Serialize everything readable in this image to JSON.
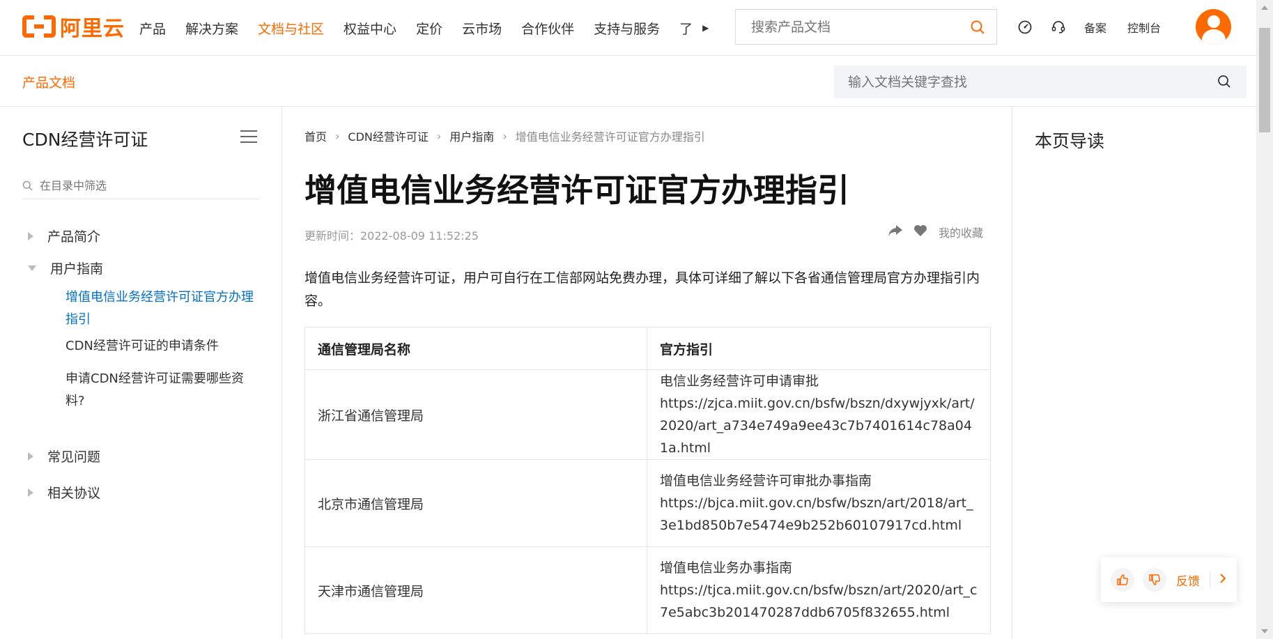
{
  "brand": {
    "logo_text": "阿里云",
    "accent": "#ff6a00",
    "link": "#0070cc"
  },
  "topnav": {
    "items": [
      {
        "label": "产品"
      },
      {
        "label": "解决方案"
      },
      {
        "label": "文档与社区",
        "active": true
      },
      {
        "label": "权益中心"
      },
      {
        "label": "定价"
      },
      {
        "label": "云市场"
      },
      {
        "label": "合作伙伴"
      },
      {
        "label": "支持与服务"
      },
      {
        "label": "了"
      }
    ],
    "search_placeholder": "搜索产品文档",
    "beian": "备案",
    "console": "控制台"
  },
  "subheader": {
    "product_docs": "产品文档",
    "doc_search_placeholder": "输入文档关键字查找"
  },
  "sidebar": {
    "title": "CDN经营许可证",
    "filter_placeholder": "在目录中筛选",
    "items": [
      {
        "label": "产品简介",
        "expanded": false
      },
      {
        "label": "用户指南",
        "expanded": true
      },
      {
        "label": "常见问题",
        "expanded": false
      },
      {
        "label": "相关协议",
        "expanded": false
      }
    ],
    "sub_items": [
      {
        "label": "增值电信业务经营许可证官方办理指引",
        "active": true
      },
      {
        "label": "CDN经营许可证的申请条件"
      },
      {
        "label": "申请CDN经营许可证需要哪些资料?"
      }
    ]
  },
  "breadcrumb": [
    "首页",
    "CDN经营许可证",
    "用户指南",
    "增值电信业务经营许可证官方办理指引"
  ],
  "article": {
    "title": "增值电信业务经营许可证官方办理指引",
    "updated": "更新时间：2022-08-09 11:52:25",
    "favorite_label": "我的收藏",
    "intro": "增值电信业务经营许可证，用户可自行在工信部网站免费办理，具体可详细了解以下各省通信管理局官方办理指引内容。",
    "table": {
      "headers": [
        "通信管理局名称",
        "官方指引"
      ],
      "rows": [
        {
          "bureau": "浙江省通信管理局",
          "guide_title": "电信业务经营许可申请审批",
          "url": "https://zjca.miit.gov.cn/bsfw/bszn/dxywjyxk/art/2020/art_a734e749a9ee43c7b7401614c78a041a.html"
        },
        {
          "bureau": "北京市通信管理局",
          "guide_title": "增值电信业务经营许可审批办事指南",
          "url": "https://bjca.miit.gov.cn/bsfw/bszn/art/2018/art_3e1bd850b7e5474e9b252b60107917cd.html"
        },
        {
          "bureau": "天津市通信管理局",
          "guide_title": "增值电信业务办事指南",
          "url": "https://tjca.miit.gov.cn/bsfw/bszn/art/2020/art_c7e5abc3b201470287ddb6705f832655.html"
        }
      ]
    }
  },
  "toc": {
    "title": "本页导读"
  },
  "feedback": {
    "label": "反馈"
  }
}
